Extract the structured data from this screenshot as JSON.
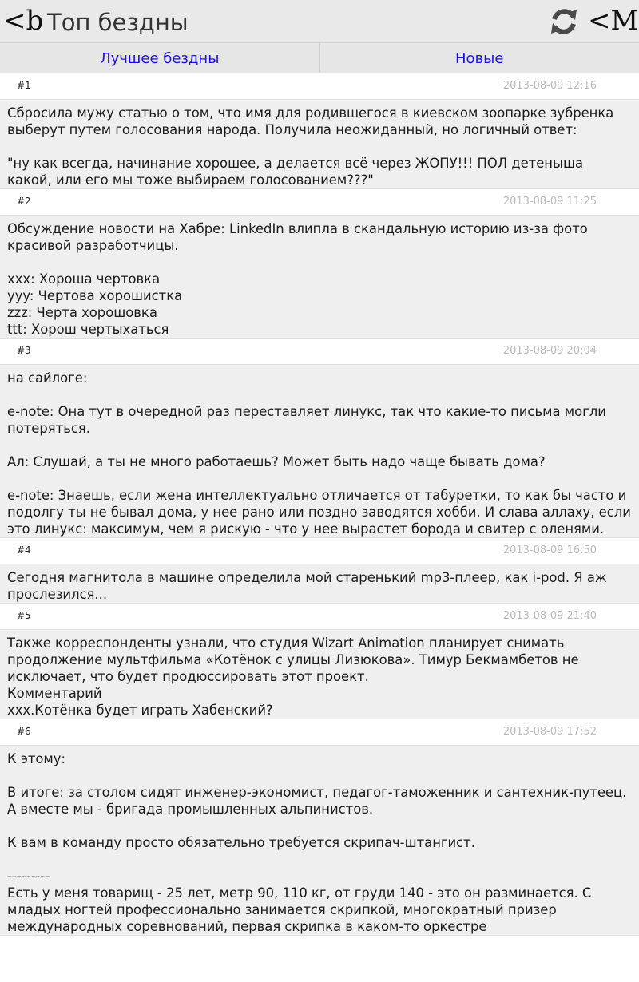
{
  "header": {
    "logo": "<b",
    "title": "Топ бездны",
    "menu_label": "<M"
  },
  "tabs": [
    {
      "label": "Лучшее бездны"
    },
    {
      "label": "Новые"
    }
  ],
  "posts": [
    {
      "num": "#1",
      "date": "2013-08-09 12:16",
      "text": "Сбросила мужу статью о том, что имя для родившегося в киевском зоопарке зубренка выберут путем голосования народа. Получила неожиданный, но логичный ответ:\n\n\"ну как всегда, начинание хорошее, а делается всё через ЖОПУ!!! ПОЛ детеныша какой, или его мы тоже выбираем голосованием???\""
    },
    {
      "num": "#2",
      "date": "2013-08-09 11:25",
      "text": "Обсуждение новости на Хабре: LinkedIn влипла в скандальную историю из-за фото красивой разработчицы.\n\nxxx: Хороша чертовка\nyyy: Чертова хорошистка\nzzz: Черта хорошовка\nttt: Хорош чертыхаться"
    },
    {
      "num": "#3",
      "date": "2013-08-09 20:04",
      "text": "на сайлоге:\n\ne-note: Она тут в очередной раз переставляет линукс, так что какие-то письма могли потеряться.\n\nАл: Слушай, а ты не много работаешь? Может быть надо чаще бывать дома?\n\ne-note: Знаешь, если жена интеллектуально отличается от табуретки, то как бы часто и подолгу ты не бывал дома, у нее рано или поздно заводятся хобби. И слава аллаху, если это линукс: максимум, чем я рискую - что у нее вырастет борода и свитер с оленями."
    },
    {
      "num": "#4",
      "date": "2013-08-09 16:50",
      "text": "Сегодня магнитола в машине определила мой старенький mp3-плеер, как i-pod. Я аж прослезился..."
    },
    {
      "num": "#5",
      "date": "2013-08-09 21:40",
      "text": "Также корреспонденты узнали, что студия Wizart Animation планирует снимать продолжение мультфильма «Котёнок с улицы Лизюкова». Тимур Бекмамбетов не исключает, что будет продюссировать этот проект.\nКомментарий\nxxx.Котёнка будет играть Хабенский?"
    },
    {
      "num": "#6",
      "date": "2013-08-09 17:52",
      "text": "К этому:\n\nВ итоге: за столом сидят инженер-экономист, педагог-таможенник и сантехник-путеец. А вместе мы - бригада промышленных альпинистов.\n\nК вам в команду просто обязательно требуется скрипач-штангист.\n\n---------\nЕсть у меня товарищ - 25 лет, метр 90, 110 кг, от груди 140 - это он разминается. С младых ногтей профессионально занимается скрипкой, многократный призер международных соревнований, первая скрипка в каком-то оркестре"
    }
  ]
}
